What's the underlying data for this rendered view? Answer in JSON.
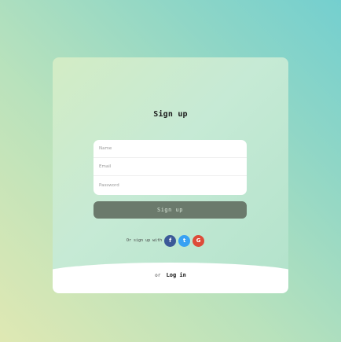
{
  "form": {
    "title": "Sign up",
    "fields": [
      {
        "name": "name",
        "placeholder": "Name"
      },
      {
        "name": "email",
        "placeholder": "Email"
      },
      {
        "name": "password",
        "placeholder": "Password"
      }
    ],
    "submit_label": "Sign up"
  },
  "social": {
    "prompt": "Or sign up with",
    "buttons": [
      {
        "icon": "facebook-icon",
        "glyph": "f",
        "color": "#3b5998"
      },
      {
        "icon": "twitter-icon",
        "glyph": "t",
        "color": "#38a1f3"
      },
      {
        "icon": "google-icon",
        "glyph": "G",
        "color": "#dd4b39"
      }
    ]
  },
  "footer": {
    "or_text": "or",
    "login_label": "Log in"
  }
}
